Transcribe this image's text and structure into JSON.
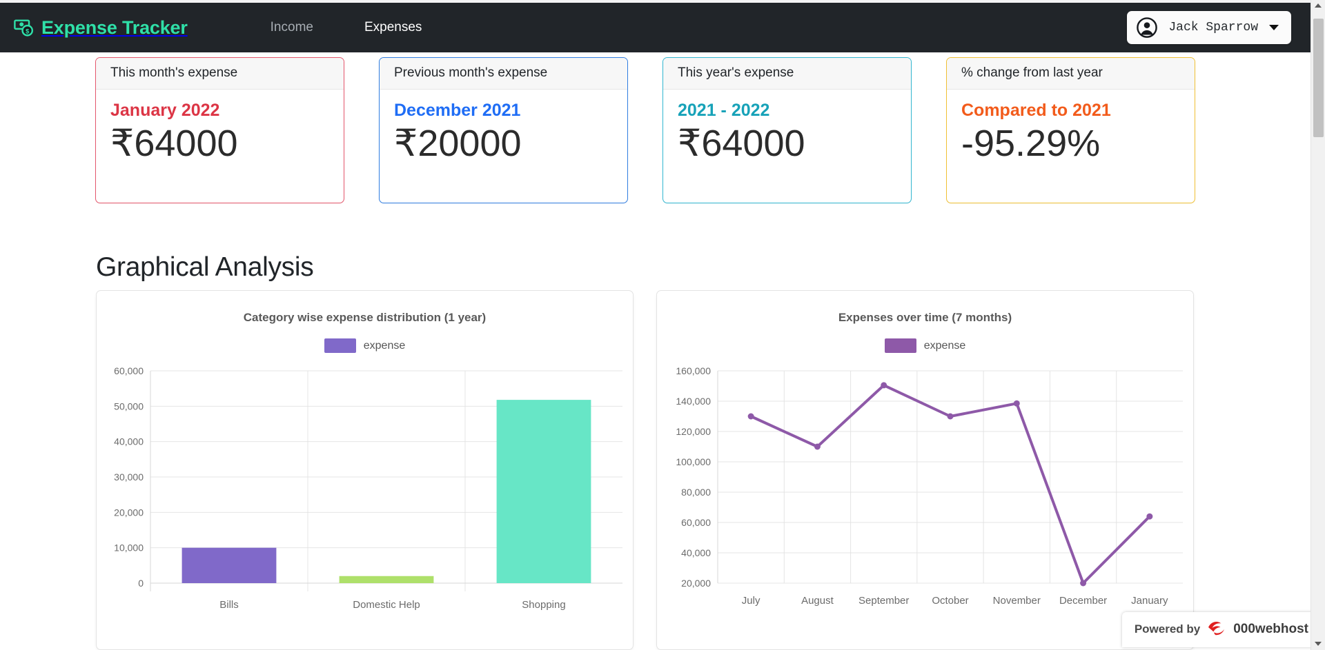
{
  "navbar": {
    "brand": "Expense Tracker",
    "brand_icon": "money-bill-icon",
    "brand_color": "#2fe0a8",
    "background": "#212529",
    "links": [
      {
        "label": "Income",
        "active": false
      },
      {
        "label": "Expenses",
        "active": true
      }
    ],
    "user": {
      "name": "Jack Sparrow",
      "avatar_icon": "user-circle-icon",
      "caret_icon": "caret-down-icon"
    }
  },
  "stat_cards": [
    {
      "header": "This month's expense",
      "subtitle": "January 2022",
      "value": "₹64000",
      "border_color": "#e4556b",
      "subtitle_color": "#dc3545"
    },
    {
      "header": "Previous month's expense",
      "subtitle": "December 2021",
      "value": "₹20000",
      "border_color": "#2f7de1",
      "subtitle_color": "#1f6df5"
    },
    {
      "header": "This year's expense",
      "subtitle": "2021 - 2022",
      "value": "₹64000",
      "border_color": "#31b6d0",
      "subtitle_color": "#17a2b8"
    },
    {
      "header": "% change from last year",
      "subtitle": "Compared to 2021",
      "value": "-95.29%",
      "border_color": "#f0c033",
      "subtitle_color": "#f25b1b"
    }
  ],
  "section": {
    "title": "Graphical Analysis"
  },
  "chart_data": [
    {
      "type": "bar",
      "title": "Category wise expense distribution (1 year)",
      "categories": [
        "Bills",
        "Domestic Help",
        "Shopping"
      ],
      "values": [
        10000,
        2000,
        51800
      ],
      "bar_colors": [
        "#8069c9",
        "#aee06a",
        "#67e6c6"
      ],
      "legend": [
        "expense"
      ],
      "legend_position": "top",
      "legend_color": "#8069c9",
      "xlabel": "",
      "ylabel": "",
      "ylim": [
        0,
        60000
      ],
      "yticks": [
        0,
        10000,
        20000,
        30000,
        40000,
        50000,
        60000
      ],
      "ytick_labels": [
        "0",
        "10,000",
        "20,000",
        "30,000",
        "40,000",
        "50,000",
        "60,000"
      ],
      "grid": true
    },
    {
      "type": "line",
      "title": "Expenses over time (7 months)",
      "categories": [
        "July",
        "August",
        "September",
        "October",
        "November",
        "December",
        "January"
      ],
      "values": [
        130000,
        110000,
        150500,
        130000,
        138500,
        20000,
        64000
      ],
      "line_color": "#8e59a8",
      "legend": [
        "expense"
      ],
      "legend_position": "top",
      "legend_color": "#8e59a8",
      "xlabel": "",
      "ylabel": "",
      "ylim": [
        20000,
        160000
      ],
      "yticks": [
        20000,
        40000,
        60000,
        80000,
        100000,
        120000,
        140000,
        160000
      ],
      "ytick_labels": [
        "20,000",
        "40,000",
        "60,000",
        "80,000",
        "100,000",
        "120,000",
        "140,000",
        "160,000"
      ],
      "grid": true
    }
  ],
  "webhost_badge": {
    "powered_by": "Powered by",
    "name": "000webhost",
    "logo_icon": "000webhost-logo-icon"
  }
}
